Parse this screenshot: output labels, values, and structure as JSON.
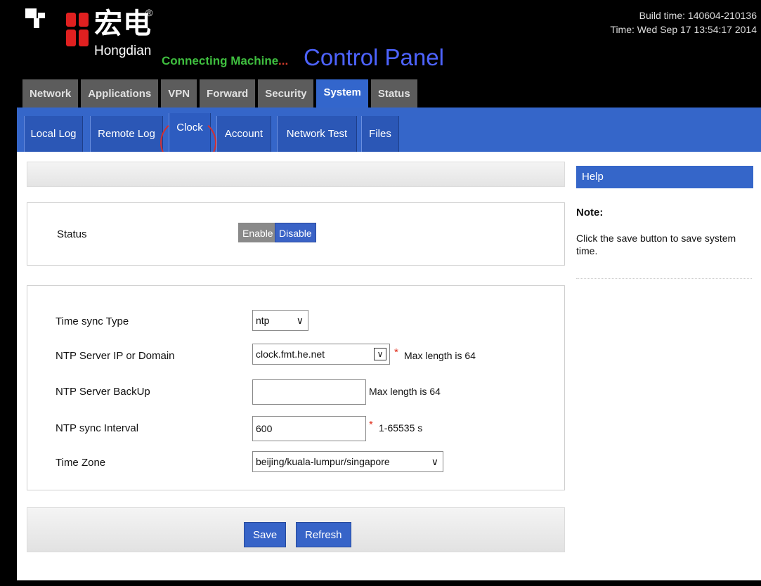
{
  "header": {
    "brand_cn": "宏电",
    "brand_reg": "®",
    "brand_en": "Hongdian",
    "tagline": "Connecting Machine",
    "tagline_dots": "...",
    "title": "Control Panel",
    "build_time": "Build time: 140604-210136",
    "current_time": "Time: Wed Sep 17 13:54:17 2014"
  },
  "main_tabs": [
    {
      "label": "Network"
    },
    {
      "label": "Applications"
    },
    {
      "label": "VPN"
    },
    {
      "label": "Forward"
    },
    {
      "label": "Security"
    },
    {
      "label": "System",
      "active": true
    },
    {
      "label": "Status"
    }
  ],
  "sub_tabs": [
    {
      "label": "Local Log"
    },
    {
      "label": "Remote Log"
    },
    {
      "label": "Clock",
      "active": true
    },
    {
      "label": "Account"
    },
    {
      "label": "Network Test"
    },
    {
      "label": "Files"
    }
  ],
  "status": {
    "label": "Status",
    "enable_label": "Enable",
    "disable_label": "Disable",
    "selected": "Disable"
  },
  "form": {
    "sync_type": {
      "label": "Time sync Type",
      "value": "ntp"
    },
    "ntp_server": {
      "label": "NTP Server IP or Domain",
      "value": "clock.fmt.he.net",
      "required": "*",
      "hint": "Max length is 64"
    },
    "ntp_backup": {
      "label": "NTP Server BackUp",
      "value": "",
      "hint": "Max length is 64"
    },
    "ntp_interval": {
      "label": "NTP sync Interval",
      "value": "600",
      "required": "*",
      "hint": "1-65535 s"
    },
    "time_zone": {
      "label": "Time Zone",
      "value": "beijing/kuala-lumpur/singapore"
    }
  },
  "actions": {
    "save_label": "Save",
    "refresh_label": "Refresh"
  },
  "help": {
    "title": "Help",
    "note_head": "Note:",
    "note_text": "Click the save button to save system time."
  },
  "colors": {
    "accent_blue": "#3566c9",
    "tab_gray": "#5c5c5c",
    "tagline_green": "#3fbf3f",
    "title_blue": "#4d63ff",
    "required_red": "#e0301e"
  }
}
